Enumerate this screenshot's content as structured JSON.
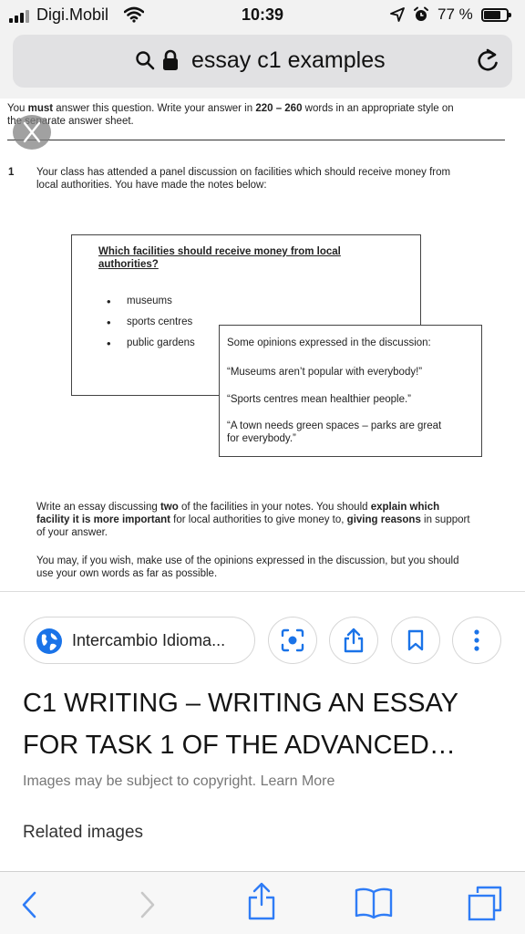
{
  "status_bar": {
    "carrier": "Digi.Mobil",
    "time": "10:39",
    "battery_percent": "77 %",
    "battery_level": 0.77
  },
  "address_bar": {
    "query": "essay c1 examples"
  },
  "document": {
    "intro_line1_pre": "You ",
    "intro_must": "must",
    "intro_line1_mid": " answer this question.  Write your answer in ",
    "intro_words": "220 – 260",
    "intro_line1_post": " words in an appropriate style on",
    "intro_line2": "the separate answer sheet.",
    "question_number": "1",
    "question_line1": "Your class has attended a panel discussion on facilities which should receive money from",
    "question_line2": "local authorities.  You have made the notes below:",
    "notes_heading_line1": "Which facilities should receive money from local",
    "notes_heading_line2": "authorities?",
    "notes_items": [
      "museums",
      "sports centres",
      "public gardens"
    ],
    "opinions_heading": "Some opinions expressed in the discussion:",
    "opinion_1": "“Museums aren’t popular with everybody!”",
    "opinion_2": "“Sports centres mean healthier people.”",
    "opinion_3_line1": "“A town needs green spaces – parks are great",
    "opinion_3_line2": "for everybody.”",
    "task_line1_pre": "Write an essay discussing ",
    "task_two": "two",
    "task_line1_mid": " of the facilities in your notes.  You should ",
    "task_explain_which": "explain which",
    "task_line2_bold": "facility it is more important",
    "task_line2_mid": " for local authorities to give money to, ",
    "task_giving_reasons": "giving reasons",
    "task_line2_post": " in support",
    "task_line3": "of your answer.",
    "may_line1": "You may, if you wish, make use of the opinions expressed in the discussion, but you should",
    "may_line2": "use your own words as far as possible."
  },
  "result": {
    "source_name": "Intercambio Idioma...",
    "title_line1": "C1 WRITING – WRITING AN ESSAY",
    "title_line2": "FOR TASK 1 OF THE ADVANCED…",
    "copyright": "Images may be subject to copyright. Learn More",
    "related": "Related images"
  },
  "icons": {
    "signal": "cellular-signal-icon",
    "wifi": "wifi-icon",
    "location": "location-arrow-icon",
    "alarm": "alarm-clock-icon",
    "battery": "battery-icon",
    "search": "search-icon",
    "lock": "lock-icon",
    "reload": "reload-icon",
    "close": "close-icon",
    "globe": "globe-icon",
    "lens": "lens-icon",
    "share": "share-icon",
    "bookmark": "bookmark-icon",
    "more": "more-vertical-icon",
    "back": "chevron-left-icon",
    "forward": "chevron-right-icon",
    "book": "book-icon",
    "tabs": "tabs-icon"
  },
  "colors": {
    "accent": "#1a73e8",
    "toolbar_icon": "#2f7cf6",
    "disabled_icon": "#c8c8c8"
  }
}
